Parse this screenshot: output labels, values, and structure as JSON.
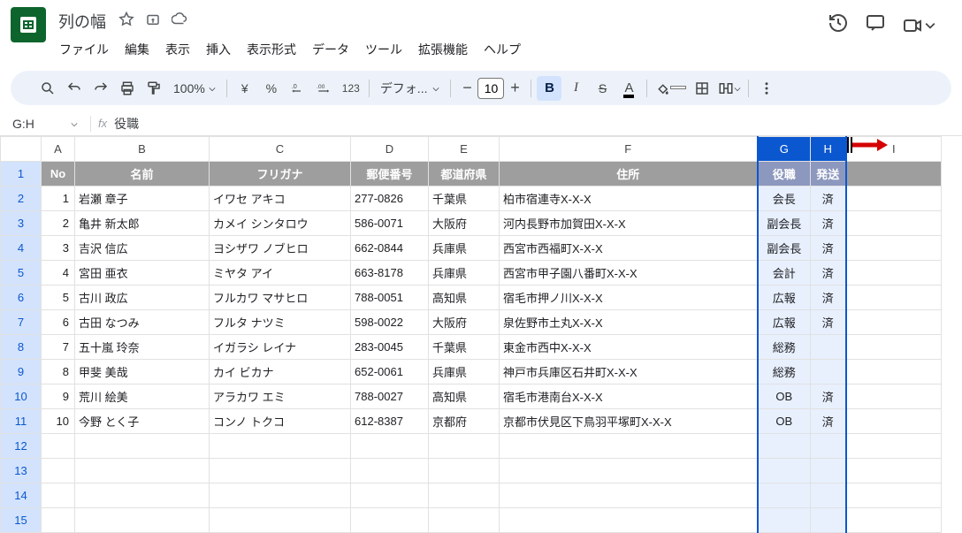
{
  "doc": {
    "title": "列の幅"
  },
  "menu": {
    "file": "ファイル",
    "edit": "編集",
    "view": "表示",
    "insert": "挿入",
    "format": "表示形式",
    "data": "データ",
    "tools": "ツール",
    "extensions": "拡張機能",
    "help": "ヘルプ"
  },
  "toolbar": {
    "zoom": "100%",
    "currency": "¥",
    "percent": "%",
    "decdec": ".0",
    "decinc": ".00",
    "numfmt": "123",
    "font": "デフォ...",
    "size": "10",
    "minus": "−",
    "plus": "+",
    "bold": "B",
    "italic": "I",
    "strike": "S",
    "color": "A"
  },
  "formula_bar": {
    "name_box": "G:H",
    "fx": "fx",
    "content": "役職"
  },
  "columns": [
    "A",
    "B",
    "C",
    "D",
    "E",
    "F",
    "G",
    "H",
    "I"
  ],
  "row_headers": [
    "1",
    "2",
    "3",
    "4",
    "5",
    "6",
    "7",
    "8",
    "9",
    "10",
    "11",
    "12",
    "13",
    "14",
    "15"
  ],
  "data_header": {
    "no": "No",
    "name": "名前",
    "kana": "フリガナ",
    "zip": "郵便番号",
    "pref": "都道府県",
    "addr": "住所",
    "role": "役職",
    "sent": "発送"
  },
  "rows": [
    {
      "no": "1",
      "name": "岩瀬 章子",
      "kana": "イワセ アキコ",
      "zip": "277-0826",
      "pref": "千葉県",
      "addr": "柏市宿連寺X-X-X",
      "role": "会長",
      "sent": "済"
    },
    {
      "no": "2",
      "name": "亀井 新太郎",
      "kana": "カメイ シンタロウ",
      "zip": "586-0071",
      "pref": "大阪府",
      "addr": "河内長野市加賀田X-X-X",
      "role": "副会長",
      "sent": "済"
    },
    {
      "no": "3",
      "name": "吉沢 信広",
      "kana": "ヨシザワ ノブヒロ",
      "zip": "662-0844",
      "pref": "兵庫県",
      "addr": "西宮市西福町X-X-X",
      "role": "副会長",
      "sent": "済"
    },
    {
      "no": "4",
      "name": "宮田 亜衣",
      "kana": "ミヤタ アイ",
      "zip": "663-8178",
      "pref": "兵庫県",
      "addr": "西宮市甲子園八番町X-X-X",
      "role": "会計",
      "sent": "済"
    },
    {
      "no": "5",
      "name": "古川 政広",
      "kana": "フルカワ マサヒロ",
      "zip": "788-0051",
      "pref": "高知県",
      "addr": "宿毛市押ノ川X-X-X",
      "role": "広報",
      "sent": "済"
    },
    {
      "no": "6",
      "name": "古田 なつみ",
      "kana": "フルタ ナツミ",
      "zip": "598-0022",
      "pref": "大阪府",
      "addr": "泉佐野市土丸X-X-X",
      "role": "広報",
      "sent": "済"
    },
    {
      "no": "7",
      "name": "五十嵐 玲奈",
      "kana": "イガラシ レイナ",
      "zip": "283-0045",
      "pref": "千葉県",
      "addr": "東金市西中X-X-X",
      "role": "総務",
      "sent": ""
    },
    {
      "no": "8",
      "name": "甲斐 美哉",
      "kana": "カイ ビカナ",
      "zip": "652-0061",
      "pref": "兵庫県",
      "addr": "神戸市兵庫区石井町X-X-X",
      "role": "総務",
      "sent": ""
    },
    {
      "no": "9",
      "name": "荒川 絵美",
      "kana": "アラカワ エミ",
      "zip": "788-0027",
      "pref": "高知県",
      "addr": "宿毛市港南台X-X-X",
      "role": "OB",
      "sent": "済"
    },
    {
      "no": "10",
      "name": "今野 とく子",
      "kana": "コンノ トクコ",
      "zip": "612-8387",
      "pref": "京都府",
      "addr": "京都市伏見区下鳥羽平塚町X-X-X",
      "role": "OB",
      "sent": "済"
    }
  ]
}
